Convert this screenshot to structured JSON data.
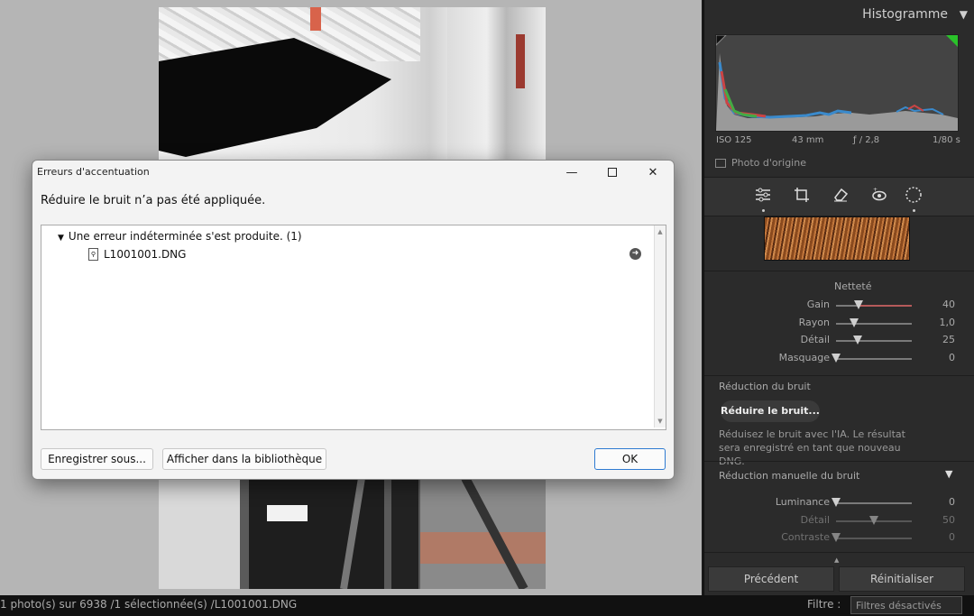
{
  "panel": {
    "histogram_title": "Histogramme",
    "meta": {
      "iso": "ISO 125",
      "focal": "43 mm",
      "aperture": "ƒ / 2,8",
      "shutter": "1/80 s"
    },
    "original_photo": "Photo d'origine",
    "sharpening": {
      "title": "Netteté",
      "sliders": [
        {
          "label": "Gain",
          "value": "40",
          "level": 0.3
        },
        {
          "label": "Rayon",
          "value": "1,0",
          "level": 0.24
        },
        {
          "label": "Détail",
          "value": "25",
          "level": 0.29
        },
        {
          "label": "Masquage",
          "value": "0",
          "level": 0.0
        }
      ]
    },
    "noise_reduction": {
      "title": "Réduction du bruit",
      "button": "Réduire le bruit...",
      "description": "Réduisez le bruit avec l'IA. Le résultat sera enregistré en tant que nouveau DNG."
    },
    "manual_nr": {
      "title": "Réduction manuelle du bruit",
      "sliders": [
        {
          "label": "Luminance",
          "value": "0",
          "level": 0.0
        },
        {
          "label": "Détail",
          "value": "50",
          "level": 0.5
        },
        {
          "label": "Contraste",
          "value": "0",
          "level": 0.0
        }
      ]
    },
    "previous_button": "Précédent",
    "reset_button": "Réinitialiser"
  },
  "status": {
    "text": "1 photo(s) sur 6938 /1 sélectionnée(s) /L1001001.DNG",
    "filter_label": "Filtre :",
    "filter_value": "Filtres désactivés"
  },
  "dialog": {
    "title": "Erreurs d'accentuation",
    "message": "Réduire le bruit n’a pas été appliquée.",
    "error_group": "Une erreur indéterminée s'est produite. (1)",
    "file": "L1001001.DNG",
    "save_as": "Enregistrer sous...",
    "show_in_library": "Afficher dans la bibliothèque",
    "ok": "OK"
  },
  "colors": {
    "accent": "#2f7bd1",
    "panel_bg": "#2b2b2b",
    "canvas_bg": "#b5b5b5"
  }
}
